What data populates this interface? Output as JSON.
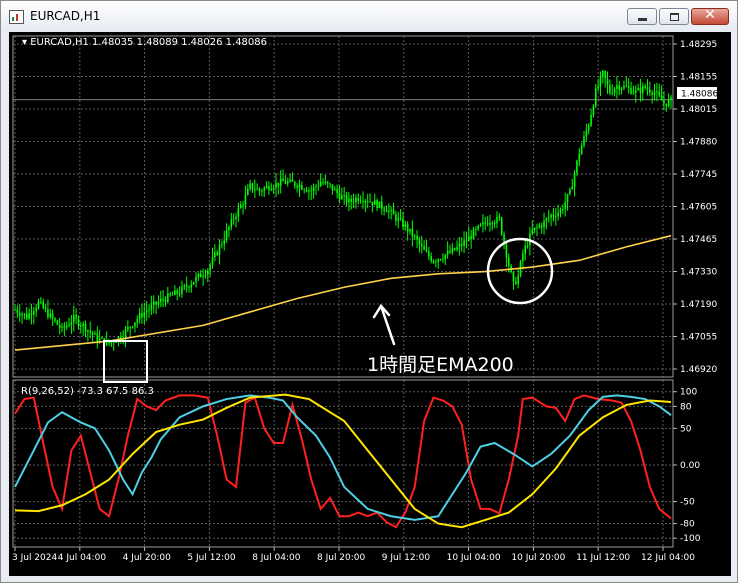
{
  "window": {
    "title": "EURCAD,H1",
    "close_glyph": "✕"
  },
  "colors": {
    "background": "#000000",
    "grid": "#5a5a5a",
    "candle": "#00ff00",
    "ema": "#ffd24a",
    "price_line": "#b0b0b0",
    "ind_red": "#ff2020",
    "ind_cyan": "#4dd0e6",
    "ind_yellow": "#ffe600",
    "annotation": "#ffffff"
  },
  "chart_data": [
    {
      "type": "candlestick",
      "title": "EURCAD,H1  1.48035 1.48089 1.48026 1.48086",
      "symbol": "EURCAD,H1",
      "ohlc_header": [
        "1.48035",
        "1.48089",
        "1.48026",
        "1.48086"
      ],
      "ylim": [
        1.4685,
        1.4837
      ],
      "y_ticks": [
        "1.48295",
        "1.48155",
        "1.48015",
        "1.47880",
        "1.47745",
        "1.47605",
        "1.47465",
        "1.47330",
        "1.47190",
        "1.47055",
        "1.46920"
      ],
      "current_price": "1.48086",
      "close_path": [
        [
          0,
          1.4715
        ],
        [
          5,
          1.4712
        ],
        [
          10,
          1.4718
        ],
        [
          15,
          1.4712
        ],
        [
          20,
          1.4706
        ],
        [
          25,
          1.4711
        ],
        [
          30,
          1.4707
        ],
        [
          35,
          1.4702
        ],
        [
          40,
          1.47
        ],
        [
          45,
          1.4703
        ],
        [
          50,
          1.4709
        ],
        [
          55,
          1.4714
        ],
        [
          62,
          1.4719
        ],
        [
          70,
          1.4723
        ],
        [
          76,
          1.4728
        ],
        [
          82,
          1.4733
        ],
        [
          88,
          1.4745
        ],
        [
          93,
          1.4756
        ],
        [
          97,
          1.4763
        ],
        [
          100,
          1.477
        ],
        [
          104,
          1.4768
        ],
        [
          108,
          1.477
        ],
        [
          114,
          1.4772
        ],
        [
          120,
          1.4771
        ],
        [
          126,
          1.4768
        ],
        [
          130,
          1.4772
        ],
        [
          134,
          1.477
        ],
        [
          138,
          1.4766
        ],
        [
          142,
          1.4763
        ],
        [
          146,
          1.4765
        ],
        [
          150,
          1.4764
        ],
        [
          154,
          1.4762
        ],
        [
          158,
          1.476
        ],
        [
          162,
          1.4756
        ],
        [
          166,
          1.4752
        ],
        [
          170,
          1.4747
        ],
        [
          174,
          1.4741
        ],
        [
          178,
          1.4737
        ],
        [
          182,
          1.4739
        ],
        [
          186,
          1.4741
        ],
        [
          190,
          1.4744
        ],
        [
          194,
          1.4748
        ],
        [
          198,
          1.4752
        ],
        [
          202,
          1.4755
        ],
        [
          206,
          1.4755
        ],
        [
          208,
          1.4745
        ],
        [
          210,
          1.4735
        ],
        [
          212,
          1.4726
        ],
        [
          214,
          1.473
        ],
        [
          216,
          1.474
        ],
        [
          220,
          1.475
        ],
        [
          224,
          1.4753
        ],
        [
          228,
          1.4757
        ],
        [
          232,
          1.4759
        ],
        [
          236,
          1.4767
        ],
        [
          240,
          1.4785
        ],
        [
          244,
          1.4798
        ],
        [
          247,
          1.4812
        ],
        [
          250,
          1.482
        ],
        [
          253,
          1.4812
        ],
        [
          256,
          1.4815
        ],
        [
          260,
          1.4814
        ],
        [
          264,
          1.4812
        ],
        [
          268,
          1.4814
        ],
        [
          272,
          1.4812
        ],
        [
          276,
          1.4807
        ],
        [
          279,
          1.4808
        ]
      ],
      "series": [
        {
          "name": "EMA200",
          "points": [
            [
              0,
              1.4697
            ],
            [
              40,
              1.4701
            ],
            [
              80,
              1.4708
            ],
            [
              100,
              1.4714
            ],
            [
              120,
              1.472
            ],
            [
              140,
              1.4725
            ],
            [
              160,
              1.4729
            ],
            [
              180,
              1.4731
            ],
            [
              200,
              1.4732
            ],
            [
              220,
              1.4734
            ],
            [
              240,
              1.4737
            ],
            [
              260,
              1.4743
            ],
            [
              279,
              1.4748
            ]
          ]
        }
      ]
    },
    {
      "type": "line",
      "title": "R(9,26,52) -73.3 67.5 86.3",
      "indicator_label": "R(9,26,52) -73.3 67.5 86.3",
      "ylim": [
        -112,
        116
      ],
      "y_ticks": [
        "100",
        "80",
        "50",
        "0.00",
        "-50",
        "-80",
        "-100"
      ],
      "x_ticks": [
        "3 Jul 2024",
        "4 Jul 04:00",
        "4 Jul 20:00",
        "5 Jul 12:00",
        "8 Jul 04:00",
        "8 Jul 20:00",
        "9 Jul 12:00",
        "10 Jul 04:00",
        "10 Jul 20:00",
        "11 Jul 12:00",
        "12 Jul 04:00"
      ],
      "series": [
        {
          "name": "9",
          "values": [
            [
              0,
              70
            ],
            [
              4,
              90
            ],
            [
              8,
              92
            ],
            [
              12,
              30
            ],
            [
              16,
              -30
            ],
            [
              20,
              -60
            ],
            [
              24,
              20
            ],
            [
              28,
              40
            ],
            [
              32,
              -10
            ],
            [
              36,
              -60
            ],
            [
              40,
              -70
            ],
            [
              44,
              -20
            ],
            [
              48,
              40
            ],
            [
              52,
              90
            ],
            [
              56,
              80
            ],
            [
              60,
              75
            ],
            [
              64,
              88
            ],
            [
              70,
              95
            ],
            [
              76,
              95
            ],
            [
              82,
              92
            ],
            [
              86,
              40
            ],
            [
              90,
              -20
            ],
            [
              94,
              -30
            ],
            [
              98,
              85
            ],
            [
              102,
              92
            ],
            [
              106,
              50
            ],
            [
              110,
              30
            ],
            [
              114,
              30
            ],
            [
              118,
              82
            ],
            [
              122,
              35
            ],
            [
              126,
              -20
            ],
            [
              130,
              -60
            ],
            [
              134,
              -45
            ],
            [
              138,
              -70
            ],
            [
              142,
              -70
            ],
            [
              146,
              -65
            ],
            [
              150,
              -70
            ],
            [
              154,
              -65
            ],
            [
              158,
              -78
            ],
            [
              162,
              -85
            ],
            [
              166,
              -65
            ],
            [
              170,
              -30
            ],
            [
              174,
              60
            ],
            [
              178,
              92
            ],
            [
              182,
              88
            ],
            [
              186,
              80
            ],
            [
              190,
              55
            ],
            [
              194,
              -20
            ],
            [
              198,
              -60
            ],
            [
              202,
              -60
            ],
            [
              206,
              -66
            ],
            [
              210,
              -20
            ],
            [
              214,
              40
            ],
            [
              216,
              90
            ],
            [
              220,
              92
            ],
            [
              226,
              80
            ],
            [
              230,
              78
            ],
            [
              234,
              60
            ],
            [
              238,
              90
            ],
            [
              242,
              95
            ],
            [
              248,
              90
            ],
            [
              254,
              88
            ],
            [
              258,
              85
            ],
            [
              262,
              60
            ],
            [
              266,
              20
            ],
            [
              270,
              -30
            ],
            [
              274,
              -60
            ],
            [
              279,
              -73
            ]
          ]
        },
        {
          "name": "26",
          "values": [
            [
              0,
              -30
            ],
            [
              8,
              20
            ],
            [
              14,
              58
            ],
            [
              20,
              72
            ],
            [
              28,
              58
            ],
            [
              34,
              50
            ],
            [
              40,
              20
            ],
            [
              46,
              -20
            ],
            [
              50,
              -40
            ],
            [
              54,
              -10
            ],
            [
              58,
              10
            ],
            [
              62,
              35
            ],
            [
              70,
              65
            ],
            [
              80,
              80
            ],
            [
              90,
              90
            ],
            [
              100,
              95
            ],
            [
              108,
              92
            ],
            [
              114,
              88
            ],
            [
              120,
              65
            ],
            [
              128,
              40
            ],
            [
              134,
              10
            ],
            [
              140,
              -30
            ],
            [
              150,
              -60
            ],
            [
              160,
              -70
            ],
            [
              170,
              -75
            ],
            [
              180,
              -70
            ],
            [
              186,
              -40
            ],
            [
              192,
              -10
            ],
            [
              198,
              25
            ],
            [
              204,
              30
            ],
            [
              212,
              15
            ],
            [
              220,
              -2
            ],
            [
              228,
              15
            ],
            [
              236,
              40
            ],
            [
              244,
              75
            ],
            [
              250,
              93
            ],
            [
              256,
              95
            ],
            [
              262,
              93
            ],
            [
              268,
              90
            ],
            [
              274,
              80
            ],
            [
              279,
              68
            ]
          ]
        },
        {
          "name": "52",
          "values": [
            [
              0,
              -62
            ],
            [
              10,
              -63
            ],
            [
              20,
              -55
            ],
            [
              30,
              -40
            ],
            [
              40,
              -20
            ],
            [
              50,
              15
            ],
            [
              60,
              45
            ],
            [
              70,
              55
            ],
            [
              80,
              62
            ],
            [
              90,
              78
            ],
            [
              100,
              92
            ],
            [
              115,
              96
            ],
            [
              125,
              90
            ],
            [
              140,
              60
            ],
            [
              150,
              20
            ],
            [
              160,
              -20
            ],
            [
              170,
              -60
            ],
            [
              180,
              -80
            ],
            [
              190,
              -85
            ],
            [
              200,
              -75
            ],
            [
              210,
              -65
            ],
            [
              220,
              -40
            ],
            [
              230,
              -5
            ],
            [
              240,
              40
            ],
            [
              250,
              65
            ],
            [
              260,
              82
            ],
            [
              270,
              88
            ],
            [
              279,
              86
            ]
          ]
        }
      ]
    }
  ],
  "annotations": {
    "ema_label": "1時間足EMA200",
    "square_marker": "square",
    "circle_marker": "circle",
    "arrow": "arrow-up-left"
  }
}
